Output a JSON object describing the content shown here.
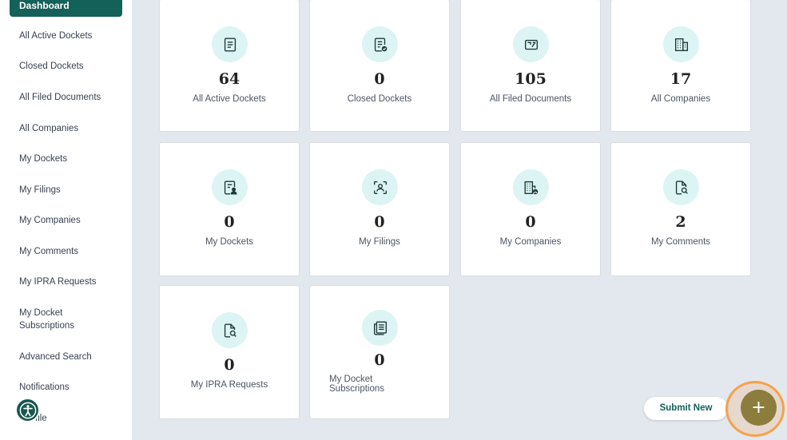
{
  "sidebar": {
    "active": "Dashboard",
    "items": [
      "All Active Dockets",
      "Closed Dockets",
      "All Filed Documents",
      "All Companies",
      "My Dockets",
      "My Filings",
      "My Companies",
      "My Comments",
      "My IPRA Requests",
      "My Docket Subscriptions",
      "Advanced Search",
      "Notifications",
      "Profile"
    ],
    "profile_visible": "file"
  },
  "cards": [
    {
      "value": "64",
      "label": "All Active Dockets",
      "icon": "document-lines-icon"
    },
    {
      "value": "0",
      "label": "Closed Dockets",
      "icon": "document-check-icon"
    },
    {
      "value": "105",
      "label": "All Filed Documents",
      "icon": "documents-stack-icon"
    },
    {
      "value": "17",
      "label": "All Companies",
      "icon": "building-icon"
    },
    {
      "value": "0",
      "label": "My Dockets",
      "icon": "document-user-icon"
    },
    {
      "value": "0",
      "label": "My Filings",
      "icon": "user-scan-icon"
    },
    {
      "value": "0",
      "label": "My Companies",
      "icon": "building-user-icon"
    },
    {
      "value": "2",
      "label": "My Comments",
      "icon": "document-search-icon"
    },
    {
      "value": "0",
      "label": "My IPRA Requests",
      "icon": "document-search-icon"
    },
    {
      "value": "0",
      "label": "My Docket Subscriptions",
      "icon": "newspaper-icon"
    }
  ],
  "actions": {
    "submit_new": "Submit New",
    "fab_symbol": "+"
  },
  "colors": {
    "primary": "#136159",
    "icon_bg": "#dcf4f4",
    "fab": "#8c7d3d",
    "highlight": "#f5a24a"
  }
}
